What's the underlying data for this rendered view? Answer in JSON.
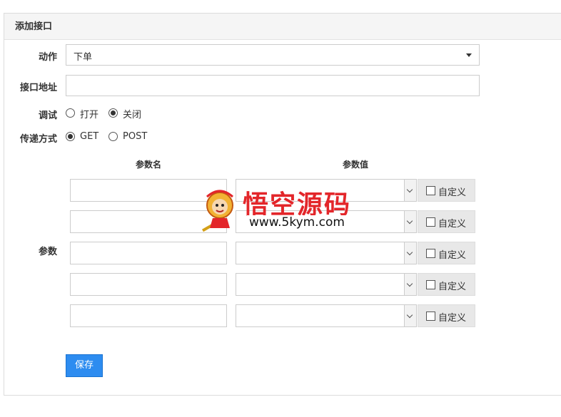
{
  "panel": {
    "title": "添加接口"
  },
  "form": {
    "action_label": "动作",
    "action_value": "下单",
    "url_label": "接口地址",
    "url_value": "",
    "debug_label": "调试",
    "debug_options": [
      {
        "label": "打开",
        "checked": false
      },
      {
        "label": "关闭",
        "checked": true
      }
    ],
    "method_label": "传递方式",
    "method_options": [
      {
        "label": "GET",
        "checked": true
      },
      {
        "label": "POST",
        "checked": false
      }
    ],
    "params_label": "参数",
    "param_name_header": "参数名",
    "param_value_header": "参数值",
    "params": [
      {
        "name": "",
        "value": "",
        "custom_label": "自定义",
        "custom_checked": false
      },
      {
        "name": "",
        "value": "",
        "custom_label": "自定义",
        "custom_checked": false
      },
      {
        "name": "",
        "value": "",
        "custom_label": "自定义",
        "custom_checked": false
      },
      {
        "name": "",
        "value": "",
        "custom_label": "自定义",
        "custom_checked": false
      },
      {
        "name": "",
        "value": "",
        "custom_label": "自定义",
        "custom_checked": false
      }
    ],
    "save_label": "保存"
  },
  "watermark": {
    "title": "悟空源码",
    "url": "www.5kym.com"
  }
}
